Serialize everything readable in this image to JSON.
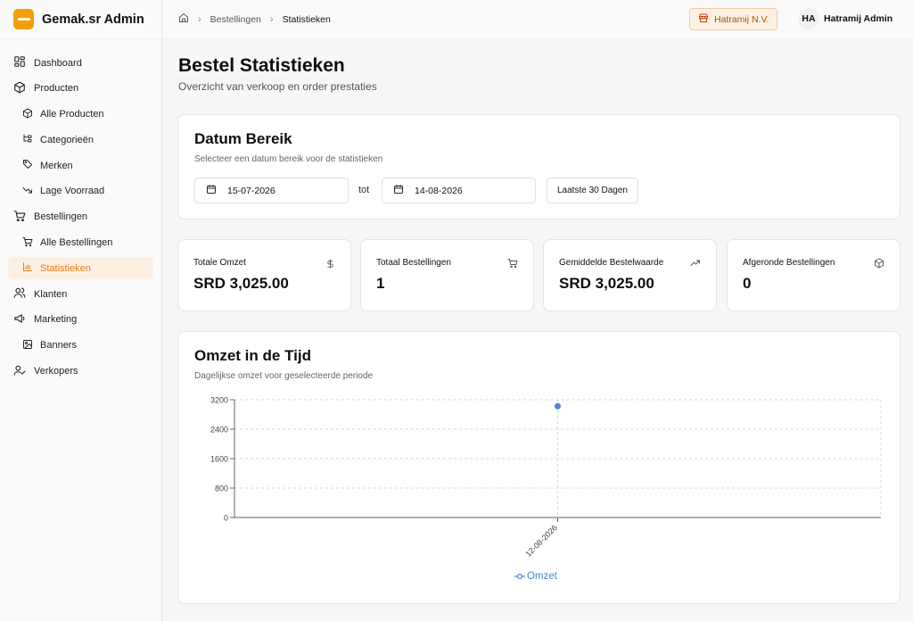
{
  "brand": {
    "name": "Gemak.sr Admin",
    "accent": "#f59e0b"
  },
  "sidebar": {
    "items": [
      {
        "label": "Dashboard",
        "icon": "dashboard-icon",
        "level": 0,
        "active": false
      },
      {
        "label": "Producten",
        "icon": "package-icon",
        "level": 0,
        "active": false
      },
      {
        "label": "Alle Producten",
        "icon": "package-icon",
        "level": 1,
        "active": false
      },
      {
        "label": "Categorieën",
        "icon": "categories-icon",
        "level": 1,
        "active": false
      },
      {
        "label": "Merken",
        "icon": "tag-icon",
        "level": 1,
        "active": false
      },
      {
        "label": "Lage Voorraad",
        "icon": "trending-down-icon",
        "level": 1,
        "active": false
      },
      {
        "label": "Bestellingen",
        "icon": "cart-icon",
        "level": 0,
        "active": false
      },
      {
        "label": "Alle Bestellingen",
        "icon": "cart-icon",
        "level": 1,
        "active": false
      },
      {
        "label": "Statistieken",
        "icon": "bar-chart-icon",
        "level": 1,
        "active": true
      },
      {
        "label": "Klanten",
        "icon": "users-icon",
        "level": 0,
        "active": false
      },
      {
        "label": "Marketing",
        "icon": "megaphone-icon",
        "level": 0,
        "active": false
      },
      {
        "label": "Banners",
        "icon": "image-icon",
        "level": 1,
        "active": false
      },
      {
        "label": "Verkopers",
        "icon": "user-check-icon",
        "level": 0,
        "active": false
      }
    ]
  },
  "header": {
    "breadcrumb": [
      "Bestellingen",
      "Statistieken"
    ],
    "store": "Hatramij N.V.",
    "user_initials": "HA",
    "user_name": "Hatramij Admin"
  },
  "page": {
    "title": "Bestel Statistieken",
    "subtitle": "Overzicht van verkoop en order prestaties"
  },
  "date_range": {
    "title": "Datum Bereik",
    "subtitle": "Selecteer een datum bereik voor de statistieken",
    "from": "15-07-2026",
    "separator": "tot",
    "to": "14-08-2026",
    "preset_label": "Laatste 30 Dagen"
  },
  "stats": [
    {
      "label": "Totale Omzet",
      "value": "SRD 3,025.00",
      "icon": "dollar-icon"
    },
    {
      "label": "Totaal Bestellingen",
      "value": "1",
      "icon": "cart-icon"
    },
    {
      "label": "Gemiddelde Bestelwaarde",
      "value": "SRD 3,025.00",
      "icon": "trending-up-icon"
    },
    {
      "label": "Afgeronde Bestellingen",
      "value": "0",
      "icon": "package-icon"
    }
  ],
  "revenue_chart": {
    "title": "Omzet in de Tijd",
    "subtitle": "Dagelijkse omzet voor geselecteerde periode"
  },
  "chart_data": {
    "type": "line",
    "x": [
      "12-08-2026"
    ],
    "series": [
      {
        "name": "Omzet",
        "values": [
          3025
        ],
        "color": "#4a86d4"
      }
    ],
    "yticks": [
      0,
      800,
      1600,
      2400,
      3200
    ],
    "ylim": [
      0,
      3200
    ],
    "grid": true,
    "legend": "bottom"
  }
}
